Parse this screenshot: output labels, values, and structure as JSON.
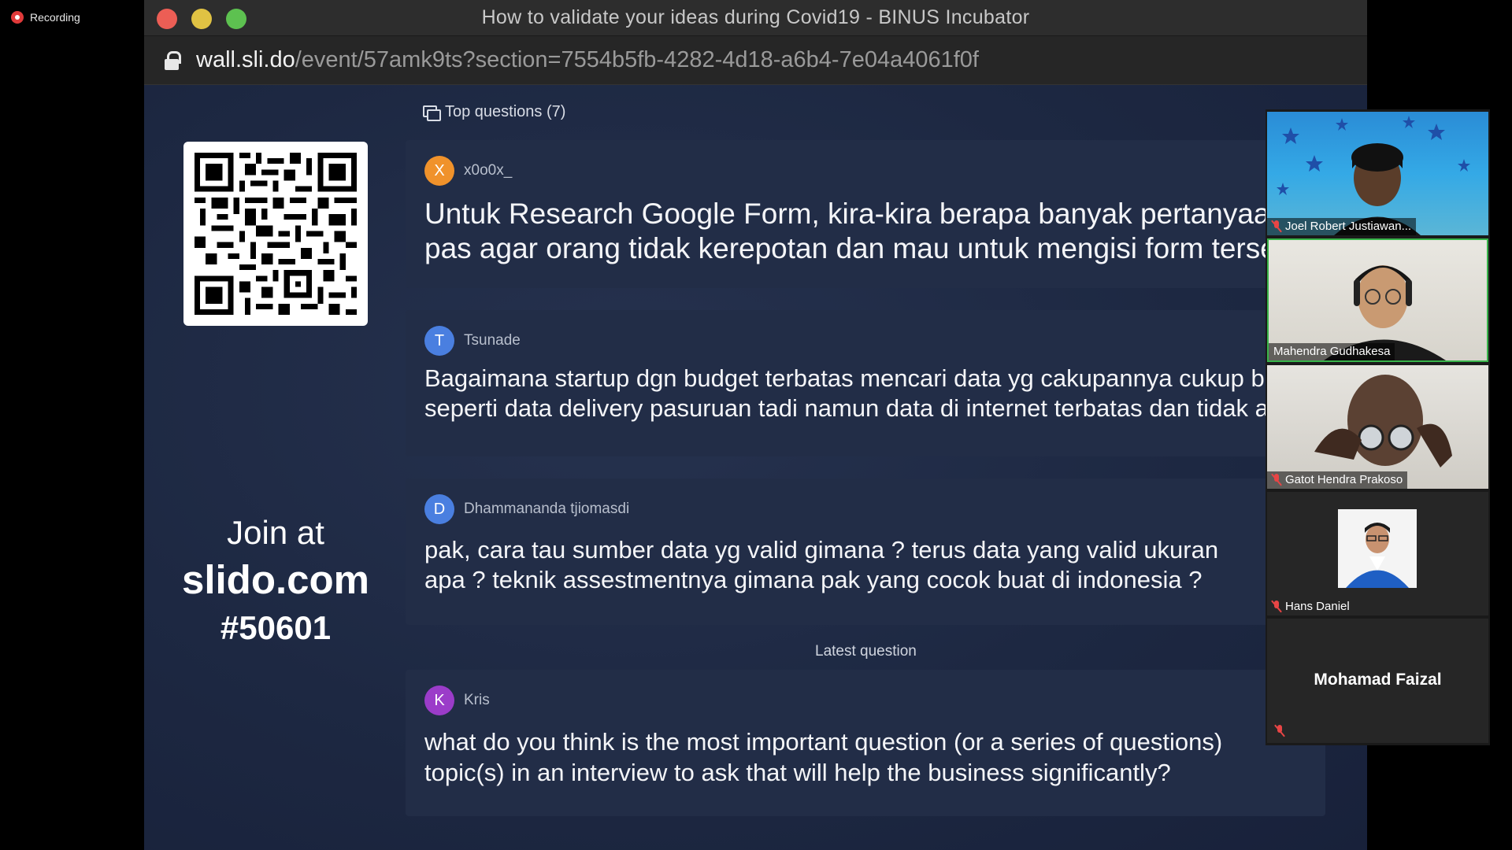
{
  "recording": {
    "label": "Recording"
  },
  "window": {
    "title": "How to validate your ideas during Covid19 - BINUS Incubator",
    "url_host": "wall.sli.do",
    "url_path": "/event/57amk9ts?section=7554b5fb-4282-4d18-a6b4-7e04a4061f0f"
  },
  "wall": {
    "join_line1": "Join at",
    "join_line2": "slido.com",
    "join_line3": "#50601",
    "top_questions_label": "Top questions (7)",
    "latest_label": "Latest question",
    "questions": [
      {
        "author": "x0o0x_",
        "initial": "X",
        "avatar_color": "#f0922b",
        "line1": "Untuk Research Google Form, kira-kira berapa banyak pertanyaan y",
        "line2": "pas agar orang tidak kerepotan dan mau untuk mengisi form tersebu"
      },
      {
        "author": "Tsunade",
        "initial": "T",
        "avatar_color": "#4a7fe0",
        "line1": "Bagaimana startup dgn budget terbatas mencari data yg cakupannya cukup be",
        "line2": "seperti data delivery pasuruan tadi namun data di internet terbatas dan tidak a"
      },
      {
        "author": "Dhammananda tjiomasdi",
        "initial": "D",
        "avatar_color": "#4a7fe0",
        "line1": "pak, cara tau sumber data yg valid gimana ? terus data yang valid ukuran",
        "line2": "apa ? teknik assestmentnya gimana pak yang cocok buat di indonesia ?"
      },
      {
        "author": "Kris",
        "initial": "K",
        "avatar_color": "#9b3cc9",
        "line1": "what do you think is the most important question (or a series of questions)",
        "line2": "topic(s) in an interview to ask that will help the business significantly?"
      }
    ]
  },
  "participants": [
    {
      "name": "Joel Robert Justiawan...",
      "muted": true
    },
    {
      "name": "Mahendra Gudhakesa",
      "muted": false
    },
    {
      "name": "Gatot Hendra Prakoso",
      "muted": true
    },
    {
      "name": "Hans Daniel",
      "muted": true
    },
    {
      "name": "Mohamad Faizal",
      "muted": true
    }
  ]
}
